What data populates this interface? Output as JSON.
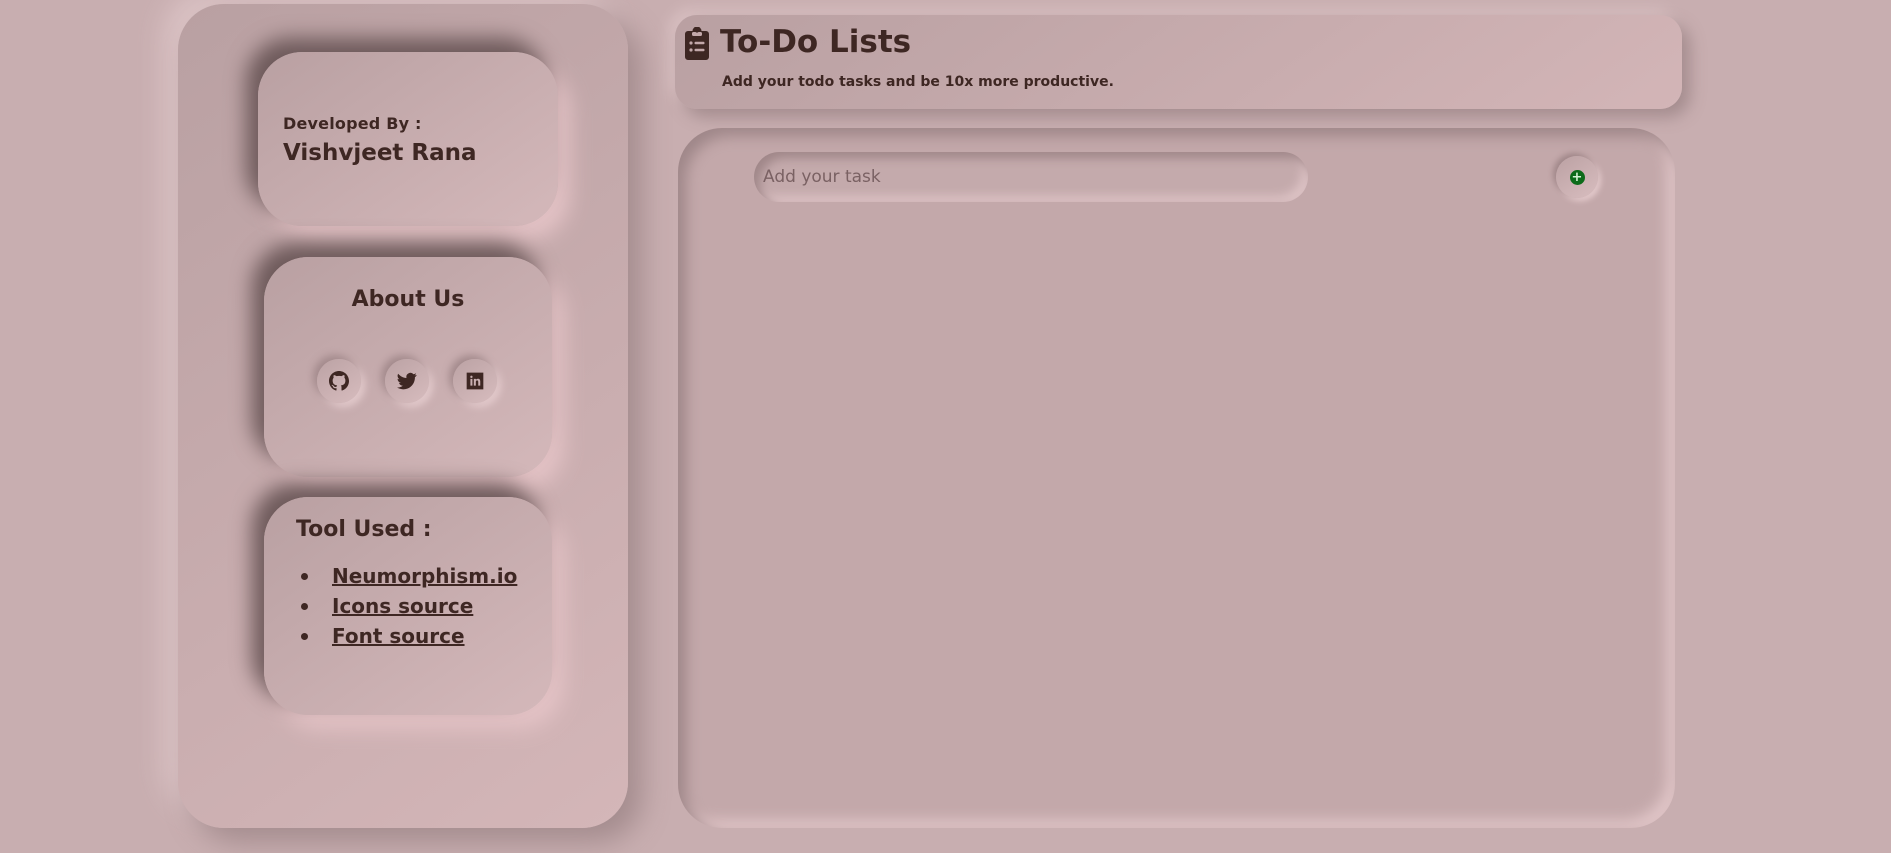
{
  "sidebar": {
    "developer": {
      "label": "Developed By :",
      "name": "Vishvjeet Rana"
    },
    "about": {
      "title": "About Us",
      "social_icons": [
        "github-icon",
        "twitter-icon",
        "linkedin-icon"
      ]
    },
    "tools": {
      "title": "Tool Used :",
      "items": [
        {
          "label": "Neumorphism.io"
        },
        {
          "label": "Icons source"
        },
        {
          "label": "Font source"
        }
      ]
    }
  },
  "header": {
    "icon": "clipboard-list-icon",
    "title": "To-Do Lists",
    "subtitle": "Add your todo tasks and be 10x more productive."
  },
  "main": {
    "task_input": {
      "value": "",
      "placeholder": "Add your task"
    },
    "add_button": {
      "icon": "plus-circle-icon",
      "symbol": "+"
    }
  },
  "colors": {
    "background": "#c8aeb0",
    "text": "#3e2723",
    "accent_add": "#0d6b1a"
  }
}
